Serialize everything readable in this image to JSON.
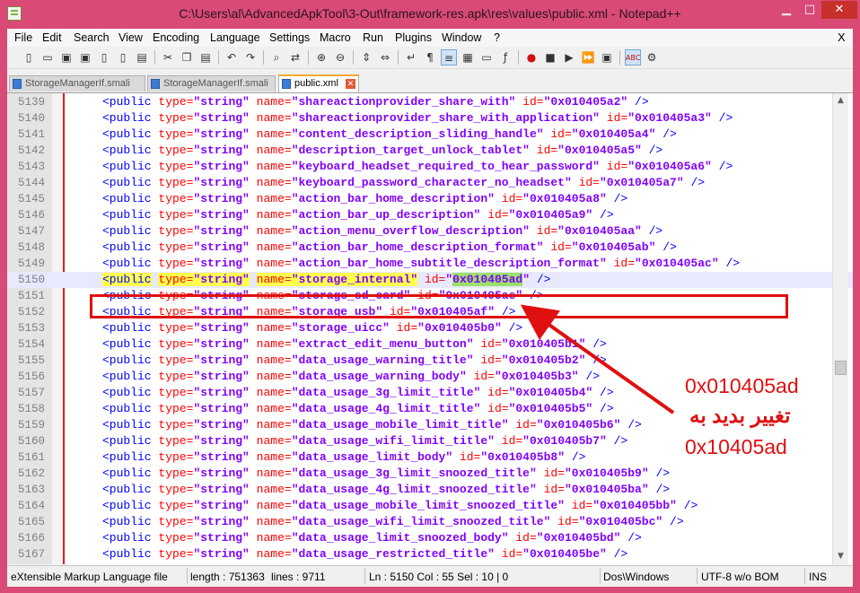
{
  "window": {
    "title": "C:\\Users\\al\\AdvancedApkTool\\3-Out\\framework-res.apk\\res\\values\\public.xml - Notepad++",
    "min_glyph": "▁",
    "max_glyph": "□",
    "close_glyph": "✕"
  },
  "menu": {
    "items": [
      "File",
      "Edit",
      "Search",
      "View",
      "Encoding",
      "Language",
      "Settings",
      "Macro",
      "Run",
      "Plugins",
      "Window",
      "?"
    ],
    "doc_close": "X"
  },
  "toolbar": {
    "icons": [
      "new-file-icon",
      "open-file-icon",
      "save-icon",
      "save-all-icon",
      "close-icon",
      "close-all-icon",
      "print-icon",
      "cut-icon",
      "copy-icon",
      "paste-icon",
      "undo-icon",
      "redo-icon",
      "find-icon",
      "replace-icon",
      "zoom-in-icon",
      "zoom-out-icon",
      "sync-vertical-icon",
      "sync-horizontal-icon",
      "word-wrap-icon",
      "show-all-chars-icon",
      "indent-guide-icon",
      "doc-map-icon",
      "folder-icon",
      "function-list-icon",
      "record-macro-icon",
      "stop-record-icon",
      "play-macro-icon",
      "play-multiple-icon",
      "save-macro-icon",
      "spell-check-icon",
      "settings-icon"
    ]
  },
  "tabs": [
    {
      "label": "StorageManagerIf.smali",
      "active": false
    },
    {
      "label": "StorageManagerIf.smali",
      "active": false
    },
    {
      "label": "public.xml",
      "active": true
    }
  ],
  "editor": {
    "current_line": 5150,
    "lines": [
      {
        "n": "5139",
        "name": "shareactionprovider_share_with",
        "id": "0x010405a2"
      },
      {
        "n": "5140",
        "name": "shareactionprovider_share_with_application",
        "id": "0x010405a3"
      },
      {
        "n": "5141",
        "name": "content_description_sliding_handle",
        "id": "0x010405a4"
      },
      {
        "n": "5142",
        "name": "description_target_unlock_tablet",
        "id": "0x010405a5"
      },
      {
        "n": "5143",
        "name": "keyboard_headset_required_to_hear_password",
        "id": "0x010405a6"
      },
      {
        "n": "5144",
        "name": "keyboard_password_character_no_headset",
        "id": "0x010405a7"
      },
      {
        "n": "5145",
        "name": "action_bar_home_description",
        "id": "0x010405a8"
      },
      {
        "n": "5146",
        "name": "action_bar_up_description",
        "id": "0x010405a9"
      },
      {
        "n": "5147",
        "name": "action_menu_overflow_description",
        "id": "0x010405aa"
      },
      {
        "n": "5148",
        "name": "action_bar_home_description_format",
        "id": "0x010405ab"
      },
      {
        "n": "5149",
        "name": "action_bar_home_subtitle_description_format",
        "id": "0x010405ac"
      },
      {
        "n": "5150",
        "name": "storage_internal",
        "id": "0x010405ad"
      },
      {
        "n": "5151",
        "name": "storage_sd_card",
        "id": "0x010405ae"
      },
      {
        "n": "5152",
        "name": "storage_usb",
        "id": "0x010405af"
      },
      {
        "n": "5153",
        "name": "storage_uicc",
        "id": "0x010405b0"
      },
      {
        "n": "5154",
        "name": "extract_edit_menu_button",
        "id": "0x010405b1"
      },
      {
        "n": "5155",
        "name": "data_usage_warning_title",
        "id": "0x010405b2"
      },
      {
        "n": "5156",
        "name": "data_usage_warning_body",
        "id": "0x010405b3"
      },
      {
        "n": "5157",
        "name": "data_usage_3g_limit_title",
        "id": "0x010405b4"
      },
      {
        "n": "5158",
        "name": "data_usage_4g_limit_title",
        "id": "0x010405b5"
      },
      {
        "n": "5159",
        "name": "data_usage_mobile_limit_title",
        "id": "0x010405b6"
      },
      {
        "n": "5160",
        "name": "data_usage_wifi_limit_title",
        "id": "0x010405b7"
      },
      {
        "n": "5161",
        "name": "data_usage_limit_body",
        "id": "0x010405b8"
      },
      {
        "n": "5162",
        "name": "data_usage_3g_limit_snoozed_title",
        "id": "0x010405b9"
      },
      {
        "n": "5163",
        "name": "data_usage_4g_limit_snoozed_title",
        "id": "0x010405ba"
      },
      {
        "n": "5164",
        "name": "data_usage_mobile_limit_snoozed_title",
        "id": "0x010405bb"
      },
      {
        "n": "5165",
        "name": "data_usage_wifi_limit_snoozed_title",
        "id": "0x010405bc"
      },
      {
        "n": "5166",
        "name": "data_usage_limit_snoozed_body",
        "id": "0x010405bd"
      },
      {
        "n": "5167",
        "name": "data_usage_restricted_title",
        "id": "0x010405be"
      }
    ],
    "tag": "<public",
    "type_attr": "type=",
    "type_val": "\"string\"",
    "name_attr": "name=",
    "id_attr": "id=",
    "close": "/>"
  },
  "annotation": {
    "line1": "0x010405ad",
    "line2": "تغيير بديد به",
    "line3": "0x10405ad",
    "color": "#e01010"
  },
  "status": {
    "file_type": "eXtensible Markup Language file",
    "length": "length : 751363",
    "lines": "lines : 9711",
    "position": "Ln : 5150    Col : 55    Sel : 10 | 0",
    "eol": "Dos\\Windows",
    "encoding": "UTF-8 w/o BOM",
    "mode": "INS"
  },
  "colors": {
    "titlebar": "#d94a77",
    "tag": "#0000ff",
    "attr": "#ff0000",
    "value": "#8000ff",
    "highlight": "#ffff50",
    "selection": "#9be06a"
  }
}
